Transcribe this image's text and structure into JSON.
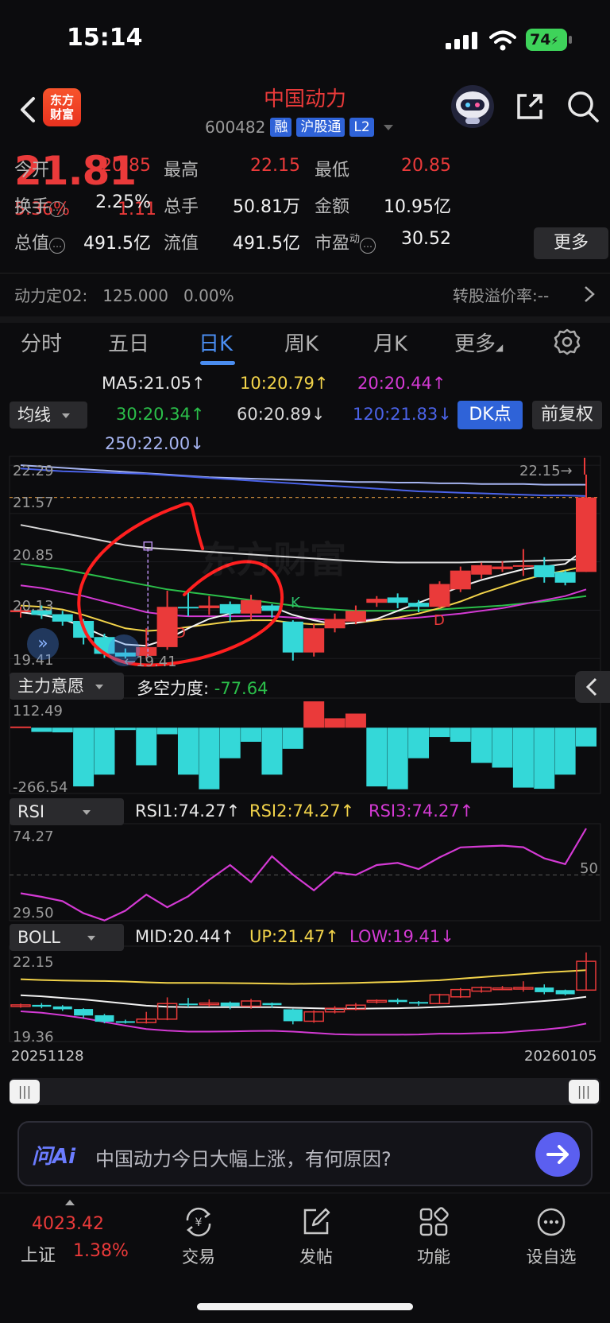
{
  "status": {
    "time": "15:14",
    "battery": "74"
  },
  "header": {
    "brand_logo": "东方\n财富",
    "stock_name": "中国动力",
    "stock_code": "600482",
    "tags": [
      "融",
      "沪股通",
      "L2"
    ]
  },
  "quote": {
    "price": "21.81",
    "pct_change": "5.36%",
    "change": "1.11",
    "rows": [
      [
        {
          "k": "今开",
          "v": "20.85",
          "c": "red"
        },
        {
          "k": "最高",
          "v": "22.15",
          "c": "red"
        },
        {
          "k": "最低",
          "v": "20.85",
          "c": "red"
        }
      ],
      [
        {
          "k": "换手",
          "v": "2.25%",
          "c": "white",
          "info": true
        },
        {
          "k": "总手",
          "v": "50.81万",
          "c": "white"
        },
        {
          "k": "金额",
          "v": "10.95亿",
          "c": "white"
        }
      ],
      [
        {
          "k": "总值",
          "v": "491.5亿",
          "c": "white",
          "info": true
        },
        {
          "k": "流值",
          "v": "491.5亿",
          "c": "white"
        },
        {
          "k": "市盈",
          "v": "30.52",
          "c": "white",
          "sup": "动",
          "info": true
        }
      ]
    ],
    "more_label": "更多"
  },
  "convertible": {
    "left": "动力定02:   125.000   0.00%",
    "right": "转股溢价率:--"
  },
  "tabs": [
    "分时",
    "五日",
    "日K",
    "周K",
    "月K",
    "更多"
  ],
  "active_tab": 2,
  "ma_legend": {
    "row1": [
      {
        "t": "MA5:21.05↑",
        "c": "#e8e8e8"
      },
      {
        "t": "10:20.79↑",
        "c": "#f2d34a"
      },
      {
        "t": "20:20.44↑",
        "c": "#d43ad4"
      }
    ],
    "row2": [
      {
        "t": "30:20.34↑",
        "c": "#2bbf4a"
      },
      {
        "t": "60:20.89↓",
        "c": "#d8d8d8"
      },
      {
        "t": "120:21.83↓",
        "c": "#4b63e8"
      }
    ],
    "row3": [
      {
        "t": "250:22.00↓",
        "c": "#a6b4f0"
      }
    ],
    "selector": "均线",
    "dk_label": "DK点",
    "fuquan_label": "前复权"
  },
  "main_chart": {
    "y_labels": [
      "22.29",
      "21.57",
      "20.85",
      "20.13",
      "19.41"
    ],
    "high_marker": "22.15→",
    "low_marker": "←19.41",
    "signal_letters": [
      "D",
      "K",
      "D"
    ],
    "watermark": "东方财富"
  },
  "candles": [
    {
      "o": 20.1,
      "c": 20.13,
      "h": 20.18,
      "l": 20.02
    },
    {
      "o": 20.13,
      "c": 20.06,
      "h": 20.2,
      "l": 20.0
    },
    {
      "o": 20.07,
      "c": 19.96,
      "h": 20.12,
      "l": 19.9
    },
    {
      "o": 19.97,
      "c": 19.72,
      "h": 20.0,
      "l": 19.62
    },
    {
      "o": 19.73,
      "c": 19.48,
      "h": 19.78,
      "l": 19.42
    },
    {
      "o": 19.5,
      "c": 19.44,
      "h": 19.56,
      "l": 19.41
    },
    {
      "o": 19.45,
      "c": 19.58,
      "h": 19.86,
      "l": 19.41
    },
    {
      "o": 19.58,
      "c": 20.18,
      "h": 20.42,
      "l": 19.54
    },
    {
      "o": 20.18,
      "c": 20.16,
      "h": 20.4,
      "l": 20.04
    },
    {
      "o": 20.16,
      "c": 20.2,
      "h": 20.34,
      "l": 20.06
    },
    {
      "o": 20.22,
      "c": 20.08,
      "h": 20.26,
      "l": 19.96
    },
    {
      "o": 20.08,
      "c": 20.28,
      "h": 20.36,
      "l": 19.98
    },
    {
      "o": 20.2,
      "c": 20.12,
      "h": 20.22,
      "l": 20.02
    },
    {
      "o": 19.96,
      "c": 19.5,
      "h": 19.98,
      "l": 19.38
    },
    {
      "o": 19.5,
      "c": 19.86,
      "h": 19.92,
      "l": 19.44
    },
    {
      "o": 19.86,
      "c": 20.0,
      "h": 20.08,
      "l": 19.8
    },
    {
      "o": 19.96,
      "c": 20.12,
      "h": 20.2,
      "l": 19.92
    },
    {
      "o": 20.24,
      "c": 20.3,
      "h": 20.34,
      "l": 20.18
    },
    {
      "o": 20.32,
      "c": 20.24,
      "h": 20.38,
      "l": 20.16
    },
    {
      "o": 20.24,
      "c": 20.18,
      "h": 20.28,
      "l": 20.1
    },
    {
      "o": 20.18,
      "c": 20.52,
      "h": 20.56,
      "l": 20.16
    },
    {
      "o": 20.44,
      "c": 20.72,
      "h": 20.78,
      "l": 20.4
    },
    {
      "o": 20.66,
      "c": 20.8,
      "h": 20.84,
      "l": 20.6
    },
    {
      "o": 20.74,
      "c": 20.78,
      "h": 20.86,
      "l": 20.7
    },
    {
      "o": 20.78,
      "c": 20.8,
      "h": 21.04,
      "l": 20.64
    },
    {
      "o": 20.8,
      "c": 20.62,
      "h": 20.92,
      "l": 20.54
    },
    {
      "o": 20.7,
      "c": 20.54,
      "h": 20.72,
      "l": 20.5
    },
    {
      "o": 20.7,
      "c": 21.81,
      "h": 22.15,
      "l": 20.7
    }
  ],
  "ma_lines": {
    "ma250": {
      "c": "#a6b4f0",
      "pts": [
        22.29,
        22.27,
        22.25,
        22.23,
        22.21,
        22.19,
        22.17,
        22.15,
        22.13,
        22.11,
        22.1,
        22.09,
        22.08,
        22.07,
        22.06,
        22.05,
        22.04,
        22.04,
        22.03,
        22.03,
        22.02,
        22.02,
        22.01,
        22.01,
        22.01,
        22.0,
        22.0,
        22.0
      ]
    },
    "ma120": {
      "c": "#4b63e8",
      "pts": [
        22.24,
        22.22,
        22.2,
        22.19,
        22.18,
        22.17,
        22.16,
        22.14,
        22.12,
        22.1,
        22.08,
        22.06,
        22.04,
        22.02,
        22.0,
        21.98,
        21.96,
        21.94,
        21.92,
        21.9,
        21.89,
        21.88,
        21.87,
        21.86,
        21.85,
        21.84,
        21.84,
        21.83
      ]
    },
    "ma60": {
      "c": "#d8d8d8",
      "pts": [
        21.4,
        21.34,
        21.28,
        21.22,
        21.16,
        21.1,
        21.06,
        21.04,
        21.02,
        21.0,
        20.98,
        20.96,
        20.94,
        20.92,
        20.9,
        20.88,
        20.86,
        20.85,
        20.84,
        20.84,
        20.84,
        20.84,
        20.85,
        20.85,
        20.86,
        20.87,
        20.88,
        20.89
      ]
    },
    "ma30": {
      "c": "#2bbf4a",
      "pts": [
        20.82,
        20.78,
        20.74,
        20.68,
        20.62,
        20.56,
        20.5,
        20.44,
        20.4,
        20.36,
        20.32,
        20.28,
        20.24,
        20.2,
        20.16,
        20.14,
        20.12,
        20.12,
        20.12,
        20.13,
        20.14,
        20.16,
        20.18,
        20.2,
        20.23,
        20.26,
        20.3,
        20.34
      ]
    },
    "ma20": {
      "c": "#d43ad4",
      "pts": [
        20.5,
        20.46,
        20.4,
        20.34,
        20.26,
        20.18,
        20.1,
        20.06,
        20.04,
        20.04,
        20.04,
        20.04,
        20.04,
        20.02,
        20.0,
        19.98,
        19.98,
        19.99,
        20.0,
        20.02,
        20.05,
        20.08,
        20.12,
        20.16,
        20.22,
        20.28,
        20.34,
        20.44
      ]
    },
    "ma10": {
      "c": "#f2d34a",
      "pts": [
        20.2,
        20.18,
        20.14,
        20.06,
        19.96,
        19.86,
        19.82,
        19.84,
        19.88,
        19.92,
        19.96,
        19.98,
        19.98,
        19.94,
        19.92,
        19.92,
        19.94,
        19.98,
        20.02,
        20.08,
        20.16,
        20.26,
        20.38,
        20.48,
        20.58,
        20.66,
        20.72,
        20.79
      ]
    },
    "ma5": {
      "c": "#f2f2f2",
      "pts": [
        20.1,
        20.06,
        20.0,
        19.88,
        19.74,
        19.62,
        19.6,
        19.7,
        19.86,
        20.0,
        20.08,
        20.16,
        20.18,
        20.06,
        19.98,
        19.92,
        19.94,
        20.0,
        20.12,
        20.24,
        20.36,
        20.48,
        20.58,
        20.66,
        20.74,
        20.78,
        20.82,
        21.05
      ]
    }
  },
  "zhuli": {
    "selector": "主力意愿",
    "label": "多空力度: -77.64",
    "value_color": "#2bbf4a",
    "y_top": "112.49",
    "y_bottom": "-266.54",
    "values": [
      5,
      -18,
      -20,
      -250,
      -200,
      -10,
      -160,
      -28,
      -200,
      -262,
      -130,
      -60,
      -200,
      -90,
      112,
      40,
      60,
      -250,
      -262,
      -130,
      -40,
      -60,
      -150,
      -170,
      -255,
      -260,
      -200,
      -80
    ]
  },
  "rsi": {
    "selector": "RSI",
    "legend": [
      {
        "t": "RSI1:74.27↑",
        "c": "#e8e8e8"
      },
      {
        "t": "RSI2:74.27↑",
        "c": "#f2d34a"
      },
      {
        "t": "RSI3:74.27↑",
        "c": "#d43ad4"
      }
    ],
    "y_top": "74.27",
    "y_bottom": "29.50",
    "mid_label": "50",
    "values": [
      40.5,
      38.6,
      36.4,
      30.1,
      26.3,
      31.4,
      39.8,
      33.2,
      38.9,
      47.5,
      55.2,
      46.3,
      59.8,
      50.2,
      42.0,
      51.4,
      50.0,
      55.2,
      56.3,
      53.1,
      59.2,
      64.4,
      64.9,
      65.3,
      64.5,
      58.7,
      55.7,
      74.27
    ]
  },
  "boll": {
    "selector": "BOLL",
    "legend": [
      {
        "t": "MID:20.44↑",
        "c": "#e8e8e8"
      },
      {
        "t": "UP:21.47↑",
        "c": "#f2d34a"
      },
      {
        "t": "LOW:19.41↓",
        "c": "#d43ad4"
      }
    ],
    "y_top": "22.15",
    "y_bottom": "19.36",
    "x_left": "20251128",
    "x_right": "20260105",
    "up": [
      21.12,
      21.09,
      21.07,
      21.06,
      21.05,
      21.03,
      21.0,
      20.98,
      20.98,
      20.98,
      20.97,
      20.96,
      20.95,
      20.94,
      20.95,
      20.96,
      20.98,
      21.0,
      21.02,
      21.05,
      21.08,
      21.14,
      21.2,
      21.26,
      21.32,
      21.38,
      21.42,
      21.47
    ],
    "mid": [
      20.5,
      20.46,
      20.4,
      20.34,
      20.26,
      20.18,
      20.1,
      20.06,
      20.04,
      20.04,
      20.04,
      20.04,
      20.04,
      20.02,
      20.0,
      19.98,
      19.98,
      19.99,
      20.0,
      20.02,
      20.05,
      20.08,
      20.12,
      20.16,
      20.22,
      20.28,
      20.34,
      20.44
    ],
    "low": [
      19.88,
      19.83,
      19.73,
      19.62,
      19.47,
      19.33,
      19.2,
      19.14,
      19.1,
      19.1,
      19.11,
      19.12,
      19.13,
      19.1,
      19.05,
      19.0,
      18.98,
      18.98,
      18.98,
      18.99,
      19.02,
      19.02,
      19.04,
      19.06,
      19.12,
      19.18,
      19.26,
      19.41
    ]
  },
  "ai_bar": {
    "logo": "问Ai",
    "prompt": "中国动力今日大幅上涨，有何原因?"
  },
  "bottom_nav": {
    "index_value": "4023.42",
    "index_label": "上证",
    "index_pct": "1.38%",
    "items": [
      "交易",
      "发帖",
      "功能",
      "设自选"
    ]
  },
  "colors": {
    "up": "#ea3a3a",
    "down": "#34d8d8",
    "accent": "#2f63d8",
    "annotation": "#ff1f1f"
  }
}
